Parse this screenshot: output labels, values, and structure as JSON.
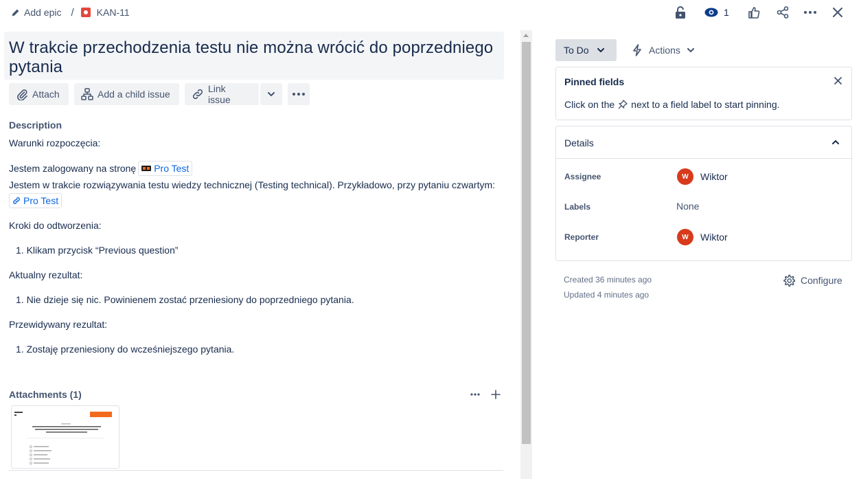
{
  "breadcrumb": {
    "epic_label": "Add epic",
    "separator": "/",
    "issue_key": "KAN-11"
  },
  "topbar": {
    "watch_count": "1"
  },
  "issue": {
    "title": "W trakcie przechodzenia testu nie można wrócić do poprzedniego pytania"
  },
  "toolbar": {
    "attach": "Attach",
    "add_child": "Add a child issue",
    "link_issue": "Link issue"
  },
  "description": {
    "heading": "Description",
    "conditions": "Warunki rozpoczęcia:",
    "logged_in": "Jestem zalogowany na stronę",
    "link1": "Pro Test",
    "in_progress": "Jestem w trakcie rozwiązywania testu wiedzy technicznej (Testing technical). Przykładowo, przy pytaniu czwartym:",
    "link2": "Pro Test",
    "steps_heading": "Kroki do odtworzenia:",
    "step1": "Klikam przycisk “Previous question”",
    "actual_heading": "Aktualny rezultat:",
    "actual1": "Nie dzieje się nic. Powinienem zostać przeniesiony do poprzedniego pytania.",
    "expected_heading": "Przewidywany rezultat:",
    "expected1": "Zostaję przeniesiony do wcześniejszego pytania."
  },
  "attachments": {
    "heading": "Attachments (1)"
  },
  "sidebar": {
    "status": "To Do",
    "actions": "Actions",
    "pinned": {
      "title": "Pinned fields",
      "hint_before": "Click on the",
      "hint_after": "next to a field label to start pinning."
    },
    "details": {
      "title": "Details",
      "assignee_label": "Assignee",
      "assignee_initial": "W",
      "assignee_name": "Wiktor",
      "labels_label": "Labels",
      "labels_value": "None",
      "reporter_label": "Reporter",
      "reporter_initial": "W",
      "reporter_name": "Wiktor"
    },
    "created": "Created 36 minutes ago",
    "updated": "Updated 4 minutes ago",
    "configure": "Configure"
  },
  "colors": {
    "accent": "#0c66e4",
    "avatar": "#d83a1c",
    "issue_type": "#e2483d"
  }
}
